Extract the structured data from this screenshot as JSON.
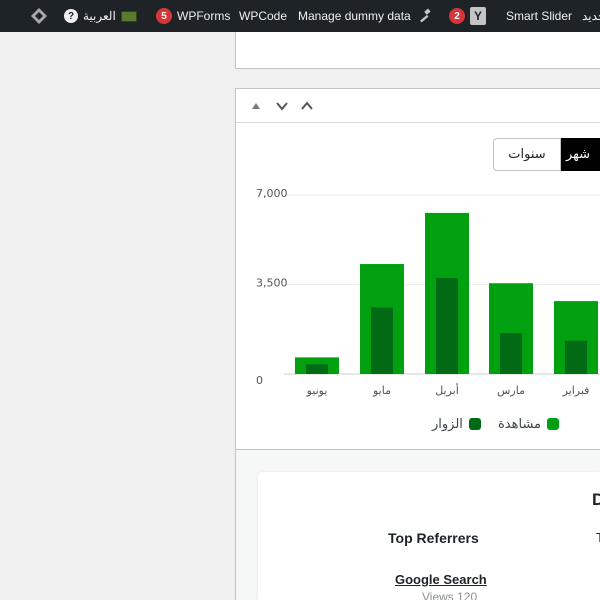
{
  "adminbar": {
    "language": "العربية",
    "help_glyph": "?",
    "wpforms_count": "5",
    "wpforms": "WPForms",
    "wpcode": "WPCode",
    "dummy": "Manage dummy data",
    "updates_count": "2",
    "yoast_glyph": "Y",
    "smart_slider": "Smart Slider",
    "new_partial": "جديد",
    "icons": [
      "wp-logo-icon",
      "help-icon",
      "flag-icon",
      "hammer-icon",
      "yoast-icon"
    ]
  },
  "panel": {
    "controls": [
      "move-up-icon",
      "move-down-icon",
      "collapse-icon"
    ],
    "segments": {
      "years": "سنوات",
      "months": "شهر"
    }
  },
  "chart_data": {
    "type": "bar",
    "categories": [
      "يونيو",
      "مايو",
      "أبريل",
      "مارس",
      "فبراير"
    ],
    "ylim": [
      0,
      7000
    ],
    "yticks": [
      "7,000",
      "3,500",
      "0"
    ],
    "series": [
      {
        "name": "مشاهدة",
        "color": "#00a010",
        "values": [
          650,
          4300,
          6300,
          3550,
          2850
        ]
      },
      {
        "name": "الزوار",
        "color": "#006b14",
        "values": [
          380,
          2600,
          3750,
          1600,
          1300
        ]
      }
    ]
  },
  "card": {
    "title_partial": "D",
    "sub_partial": "T",
    "referrers_heading": "Top Referrers",
    "referrer_name": "Google Search",
    "referrer_views": "Views 120"
  }
}
